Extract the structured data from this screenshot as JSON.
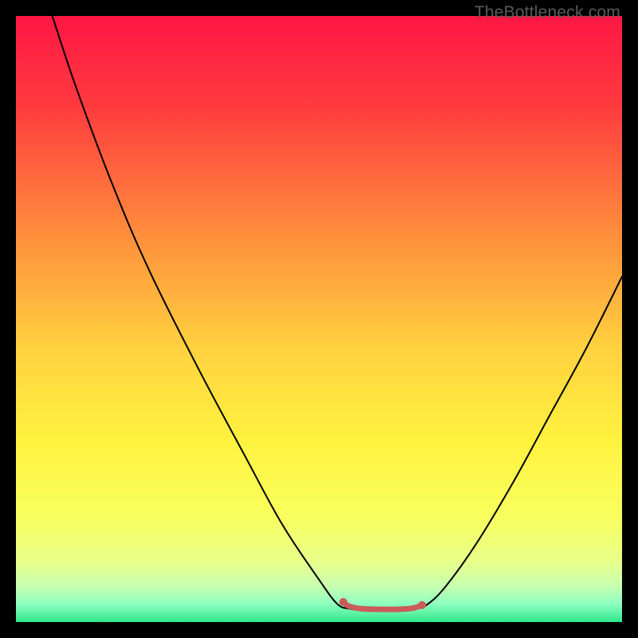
{
  "watermark": "TheBottleneck.com",
  "chart_data": {
    "type": "line",
    "title": "",
    "xlabel": "",
    "ylabel": "",
    "xlim": [
      0,
      100
    ],
    "ylim": [
      0,
      100
    ],
    "background_gradient": {
      "stops": [
        {
          "offset": 0.0,
          "color": "#ff1744"
        },
        {
          "offset": 0.15,
          "color": "#ff3b3f"
        },
        {
          "offset": 0.35,
          "color": "#ff8a3c"
        },
        {
          "offset": 0.55,
          "color": "#ffd23f"
        },
        {
          "offset": 0.7,
          "color": "#fff23f"
        },
        {
          "offset": 0.82,
          "color": "#f9ff5c"
        },
        {
          "offset": 0.9,
          "color": "#e8ff8a"
        },
        {
          "offset": 0.94,
          "color": "#c8ffb0"
        },
        {
          "offset": 0.97,
          "color": "#8effc0"
        },
        {
          "offset": 1.0,
          "color": "#30e88a"
        }
      ]
    },
    "series": [
      {
        "name": "bottleneck-curve",
        "color": "#000000",
        "stroke_width": 2,
        "points": [
          {
            "x": 6.0,
            "y": 100.0
          },
          {
            "x": 10.0,
            "y": 88.0
          },
          {
            "x": 16.0,
            "y": 72.0
          },
          {
            "x": 22.0,
            "y": 58.0
          },
          {
            "x": 30.0,
            "y": 42.0
          },
          {
            "x": 38.0,
            "y": 27.0
          },
          {
            "x": 44.0,
            "y": 16.0
          },
          {
            "x": 50.0,
            "y": 7.0
          },
          {
            "x": 53.0,
            "y": 3.0
          },
          {
            "x": 55.0,
            "y": 2.2
          },
          {
            "x": 57.0,
            "y": 2.0
          },
          {
            "x": 60.0,
            "y": 2.0
          },
          {
            "x": 63.0,
            "y": 2.0
          },
          {
            "x": 66.0,
            "y": 2.2
          },
          {
            "x": 68.0,
            "y": 3.0
          },
          {
            "x": 71.0,
            "y": 6.0
          },
          {
            "x": 76.0,
            "y": 13.0
          },
          {
            "x": 82.0,
            "y": 23.0
          },
          {
            "x": 88.0,
            "y": 34.0
          },
          {
            "x": 94.0,
            "y": 45.0
          },
          {
            "x": 100.0,
            "y": 57.0
          }
        ]
      },
      {
        "name": "trough-marker",
        "color": "#cc5a5a",
        "stroke_width": 7,
        "points": [
          {
            "x": 54.0,
            "y": 3.3
          },
          {
            "x": 55.0,
            "y": 2.6
          },
          {
            "x": 57.0,
            "y": 2.2
          },
          {
            "x": 60.0,
            "y": 2.1
          },
          {
            "x": 63.0,
            "y": 2.1
          },
          {
            "x": 65.5,
            "y": 2.3
          },
          {
            "x": 67.0,
            "y": 2.8
          }
        ],
        "endpoints": [
          {
            "x": 54.0,
            "y": 3.3
          },
          {
            "x": 67.0,
            "y": 2.8
          }
        ]
      }
    ]
  }
}
